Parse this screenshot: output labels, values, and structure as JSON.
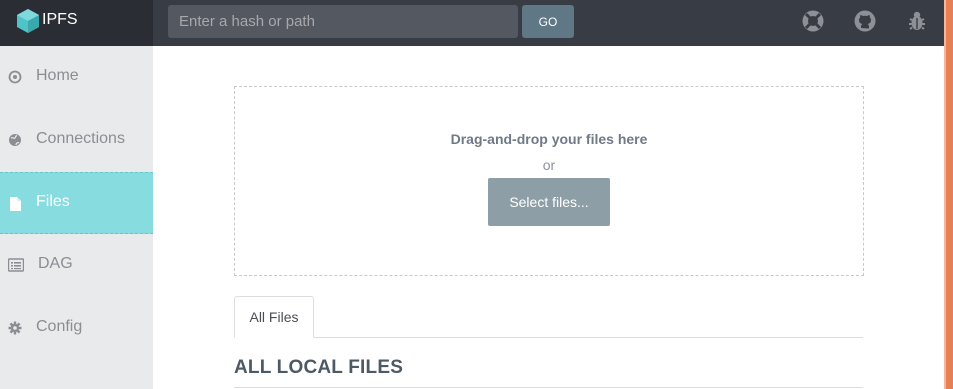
{
  "app": {
    "name": "IPFS"
  },
  "header": {
    "search_placeholder": "Enter a hash or path",
    "search_value": "",
    "go_label": "GO",
    "icons": [
      "lifebuoy-icon",
      "github-icon",
      "bug-icon"
    ]
  },
  "sidebar": {
    "items": [
      {
        "label": "Home",
        "icon": "home-icon",
        "active": false
      },
      {
        "label": "Connections",
        "icon": "globe-icon",
        "active": false
      },
      {
        "label": "Files",
        "icon": "file-icon",
        "active": true
      },
      {
        "label": "DAG",
        "icon": "list-icon",
        "active": false
      },
      {
        "label": "Config",
        "icon": "gear-icon",
        "active": false
      }
    ]
  },
  "main": {
    "dropzone": {
      "title": "Drag-and-drop your files here",
      "or": "or",
      "select_label": "Select files..."
    },
    "tabs": [
      {
        "label": "All Files",
        "active": true
      }
    ],
    "section_title": "ALL LOCAL FILES"
  },
  "colors": {
    "header_bg": "#383c45",
    "logo_bg": "#2b2d35",
    "sidebar_bg": "#e9eaec",
    "active_nav": "#86dcdf",
    "go_button": "#607785",
    "select_button": "#8e9ea6",
    "right_stripe": "#e97f55"
  }
}
